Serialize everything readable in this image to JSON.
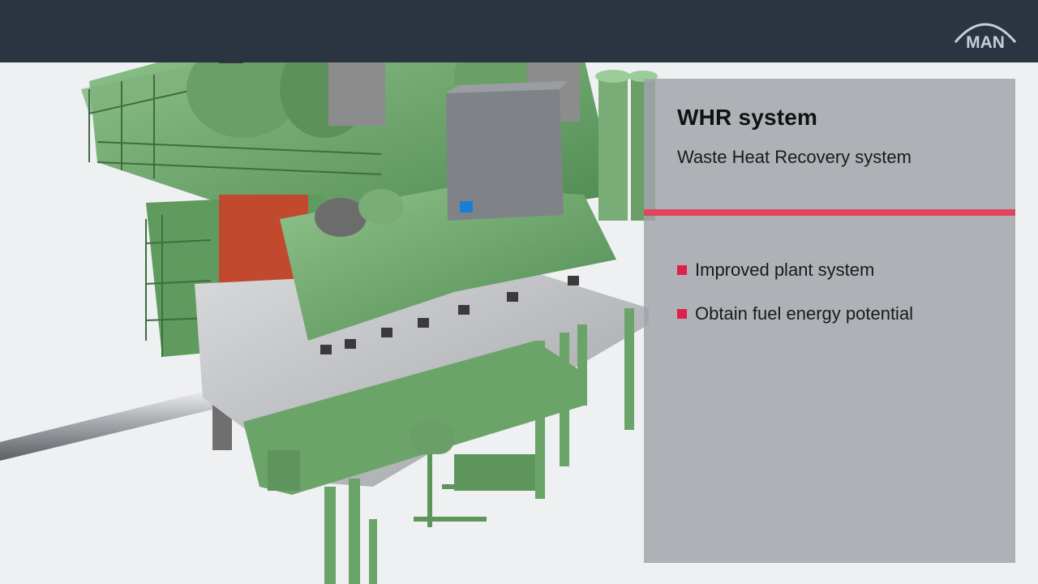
{
  "brand": {
    "logo_text": "MAN",
    "logo_icon": "man-logo-icon"
  },
  "colors": {
    "topbar": "#2b3441",
    "accent_rule": "#e2435f",
    "bullet_square": "#e0204a",
    "machinery_green": "#6fa56d",
    "gearbox_red": "#c0492e",
    "generator_grey": "#808489",
    "panel_overlay": "#a0a4aa"
  },
  "panel": {
    "title": "WHR system",
    "subtitle": "Waste Heat Recovery system",
    "bullets": [
      {
        "text": "Improved plant system"
      },
      {
        "text": "Obtain fuel energy potential"
      }
    ]
  }
}
